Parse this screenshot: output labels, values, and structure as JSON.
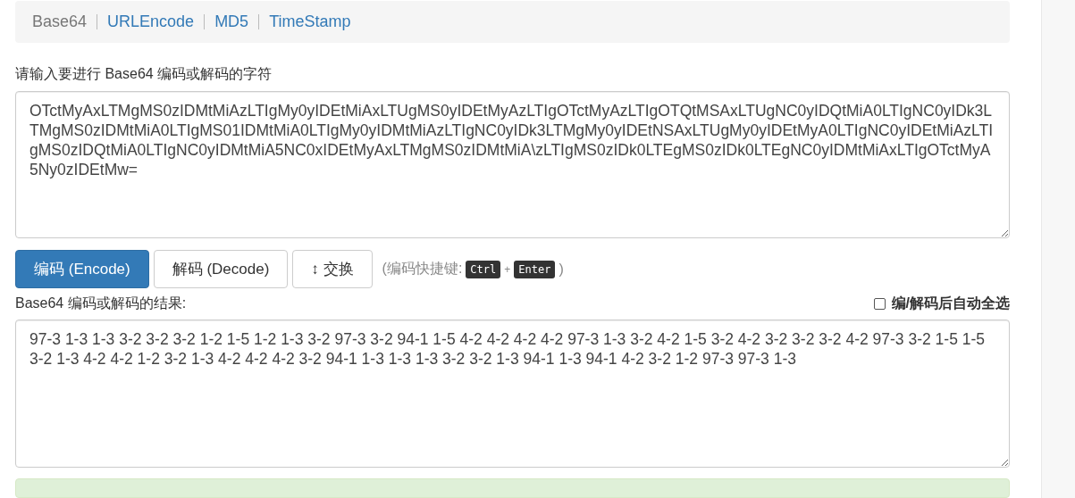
{
  "nav": [
    {
      "label": "Base64",
      "selected": true
    },
    {
      "label": "URLEncode",
      "selected": false
    },
    {
      "label": "MD5",
      "selected": false
    },
    {
      "label": "TimeStamp",
      "selected": false
    }
  ],
  "input": {
    "label": "请输入要进行 Base64 编码或解码的字符",
    "value": "OTctMyAxLTMgMS0zIDMtMiAzLTIgMy0yIDEtMiAxLTUgMS0yIDEtMyAzLTIgOTctMyAzLTIgOTQtMSAxLTUgNC0yIDQtMiA0LTIgNC0yIDk3LTMgMS0zIDMtMiA0LTIgMS01IDMtMiA0LTIgMy0yIDMtMiAzLTIgNC0yIDk3LTMgMy0yIDEtNSAxLTUgMy0yIDEtMyA0LTIgNC0yIDEtMiAzLTIgMS0zIDQtMiA0LTIgNC0yIDMtMiA5NC0xIDEtMyAxLTMgMS0zIDMtMiA\\zLTIgMS0zIDk0LTEgMS0zIDk0LTEgNC0yIDMtMiAxLTIgOTctMyA5Ny0zIDEtMw="
  },
  "buttons": [
    {
      "label": "编码 (Encode)",
      "kind": "primary"
    },
    {
      "label": "解码 (Decode)",
      "kind": "default"
    },
    {
      "label": "↕ 交换",
      "kind": "default"
    }
  ],
  "shortcut": {
    "prefix": "(编码快捷键:",
    "keys": [
      "Ctrl",
      "Enter"
    ],
    "joiner": "+",
    "suffix": ")"
  },
  "output": {
    "label": "Base64 编码或解码的结果:",
    "auto_select": {
      "label": "编/解码后自动全选",
      "checked": false
    },
    "value": "97-3 1-3 1-3 3-2 3-2 3-2 1-2 1-5 1-2 1-3 3-2 97-3 3-2 94-1 1-5 4-2 4-2 4-2 4-2 97-3 1-3 3-2 4-2 1-5 3-2 4-2 3-2 3-2 3-2 4-2 97-3 3-2 1-5 1-5 3-2 1-3 4-2 4-2 1-2 3-2 1-3 4-2 4-2 4-2 3-2 94-1 1-3 1-3 1-3 3-2 3-2 1-3 94-1 1-3 94-1 4-2 3-2 1-2 97-3 97-3 1-3"
  }
}
